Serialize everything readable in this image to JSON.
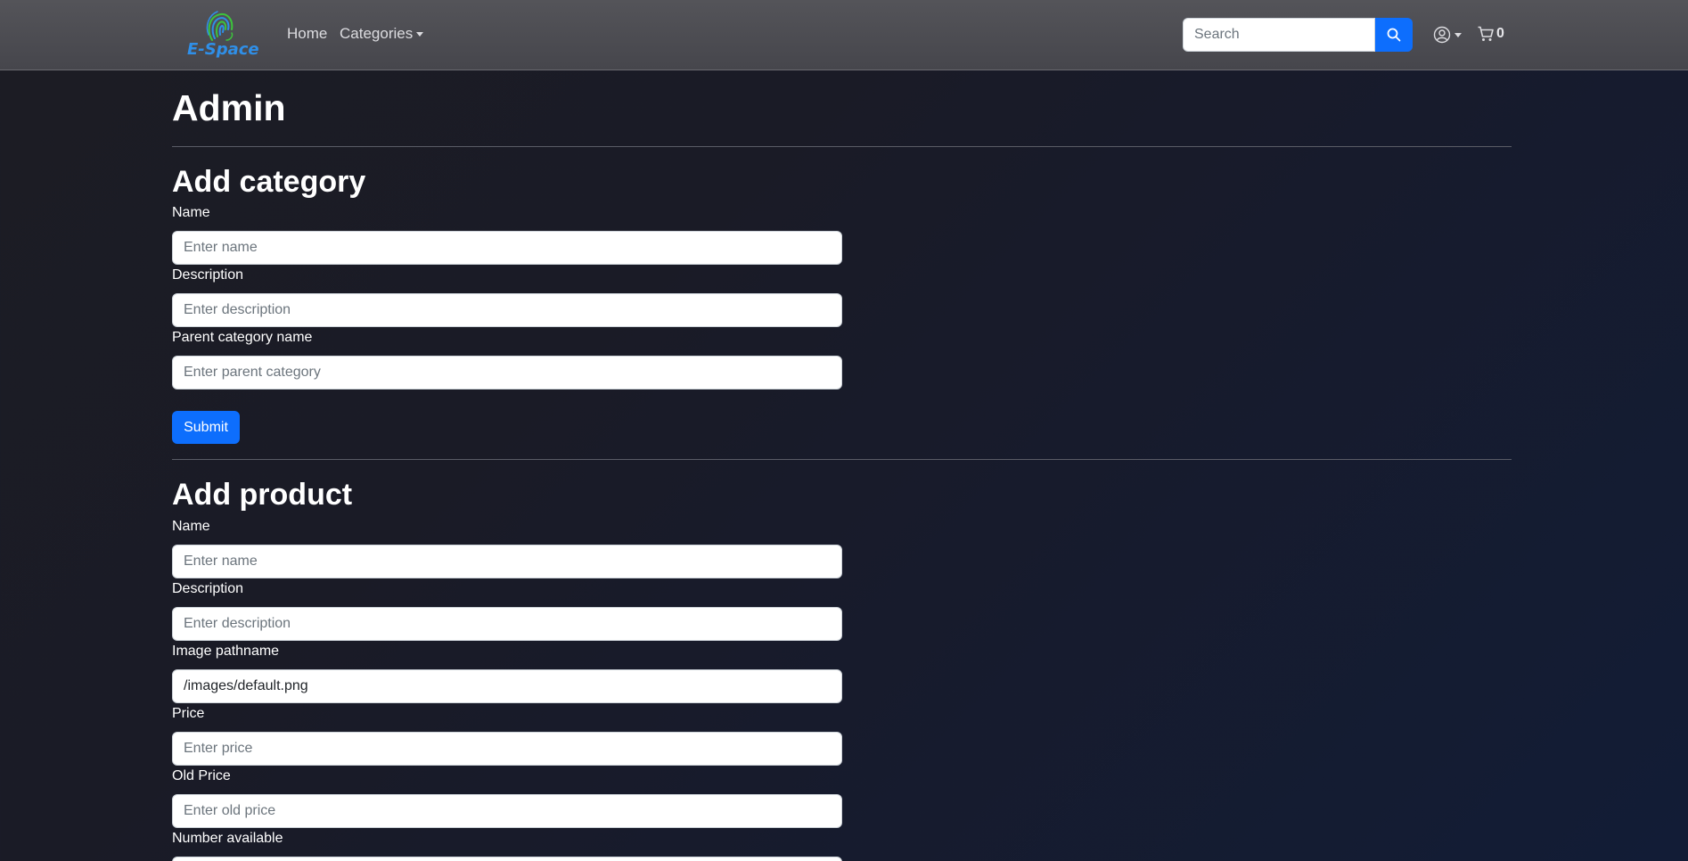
{
  "nav": {
    "brand": "E-Space",
    "home_label": "Home",
    "categories_label": "Categories",
    "search_placeholder": "Search",
    "cart_count": "0"
  },
  "page": {
    "title": "Admin"
  },
  "category_form": {
    "heading": "Add category",
    "name_label": "Name",
    "name_placeholder": "Enter name",
    "description_label": "Description",
    "description_placeholder": "Enter description",
    "parent_label": "Parent category name",
    "parent_placeholder": "Enter parent category",
    "submit_label": "Submit"
  },
  "product_form": {
    "heading": "Add product",
    "name_label": "Name",
    "name_placeholder": "Enter name",
    "description_label": "Description",
    "description_placeholder": "Enter description",
    "image_label": "Image pathname",
    "image_value": "/images/default.png",
    "price_label": "Price",
    "price_placeholder": "Enter price",
    "old_price_label": "Old Price",
    "old_price_placeholder": "Enter old price",
    "number_label": "Number available"
  },
  "colors": {
    "accent": "#0d6efd",
    "navbar": "#4b4b51",
    "brand_blue": "#2f8fe8",
    "brand_green": "#3cc43c"
  },
  "icons": [
    "fingerprint-logo-icon",
    "search-icon",
    "user-circle-icon",
    "cart-icon"
  ]
}
